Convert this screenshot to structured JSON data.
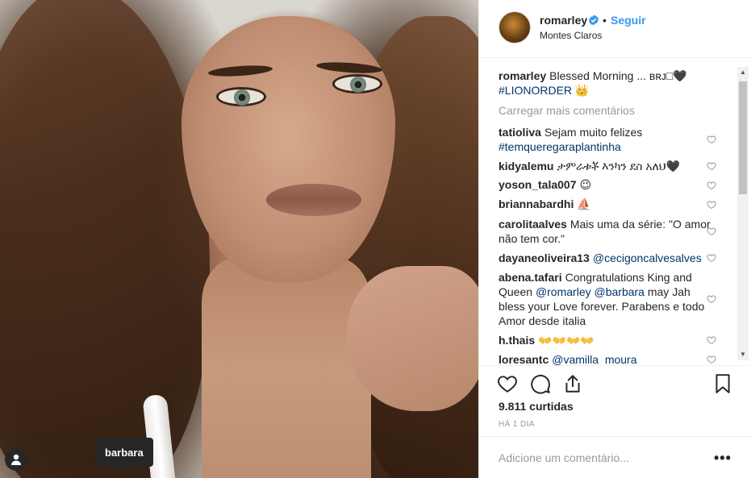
{
  "post": {
    "username": "romarley",
    "follow_label": "Seguir",
    "separator": "•",
    "location": "Montes Claros",
    "tag_label": "barbara"
  },
  "caption": {
    "user": "romarley",
    "text": "Blessed Morning ... ʙʀᴊ□🖤",
    "hashtag": "#LIONORDER 👑"
  },
  "load_more_label": "Carregar mais comentários",
  "comments": [
    {
      "user": "tatioliva",
      "text": "Sejam muito felizes",
      "link": "#temqueregaraplantinha"
    },
    {
      "user": "kidyalemu",
      "text": "ታምራቱቾ እንካን ደስ አለህ🖤"
    },
    {
      "user": "yoson_tala007",
      "text": "😉"
    },
    {
      "user": "briannabardhi",
      "text": "⛵"
    },
    {
      "user": "carolitaalves",
      "text": "Mais uma da série: \"O amor não tem cor.\""
    },
    {
      "user": "dayaneoliveira13",
      "link": "@cecigoncalvesalves"
    },
    {
      "user": "abena.tafari",
      "text_a": "Congratulations King and Queen",
      "link_a": "@romarley",
      "link_b": "@barbara",
      "text_b": "may Jah bless your Love forever. Parabens e todo Amor desde italia"
    },
    {
      "user": "h.thais",
      "text": "👐👐👐👐"
    },
    {
      "user": "loresantc",
      "link": "@vamilla_moura"
    }
  ],
  "likes_label": "9.811 curtidas",
  "time_label": "HÁ 1 DIA",
  "add_comment_placeholder": "Adicione um comentário...",
  "more_label": "•••",
  "colors": {
    "link": "#003569",
    "follow": "#3897f0",
    "muted": "#999999"
  }
}
